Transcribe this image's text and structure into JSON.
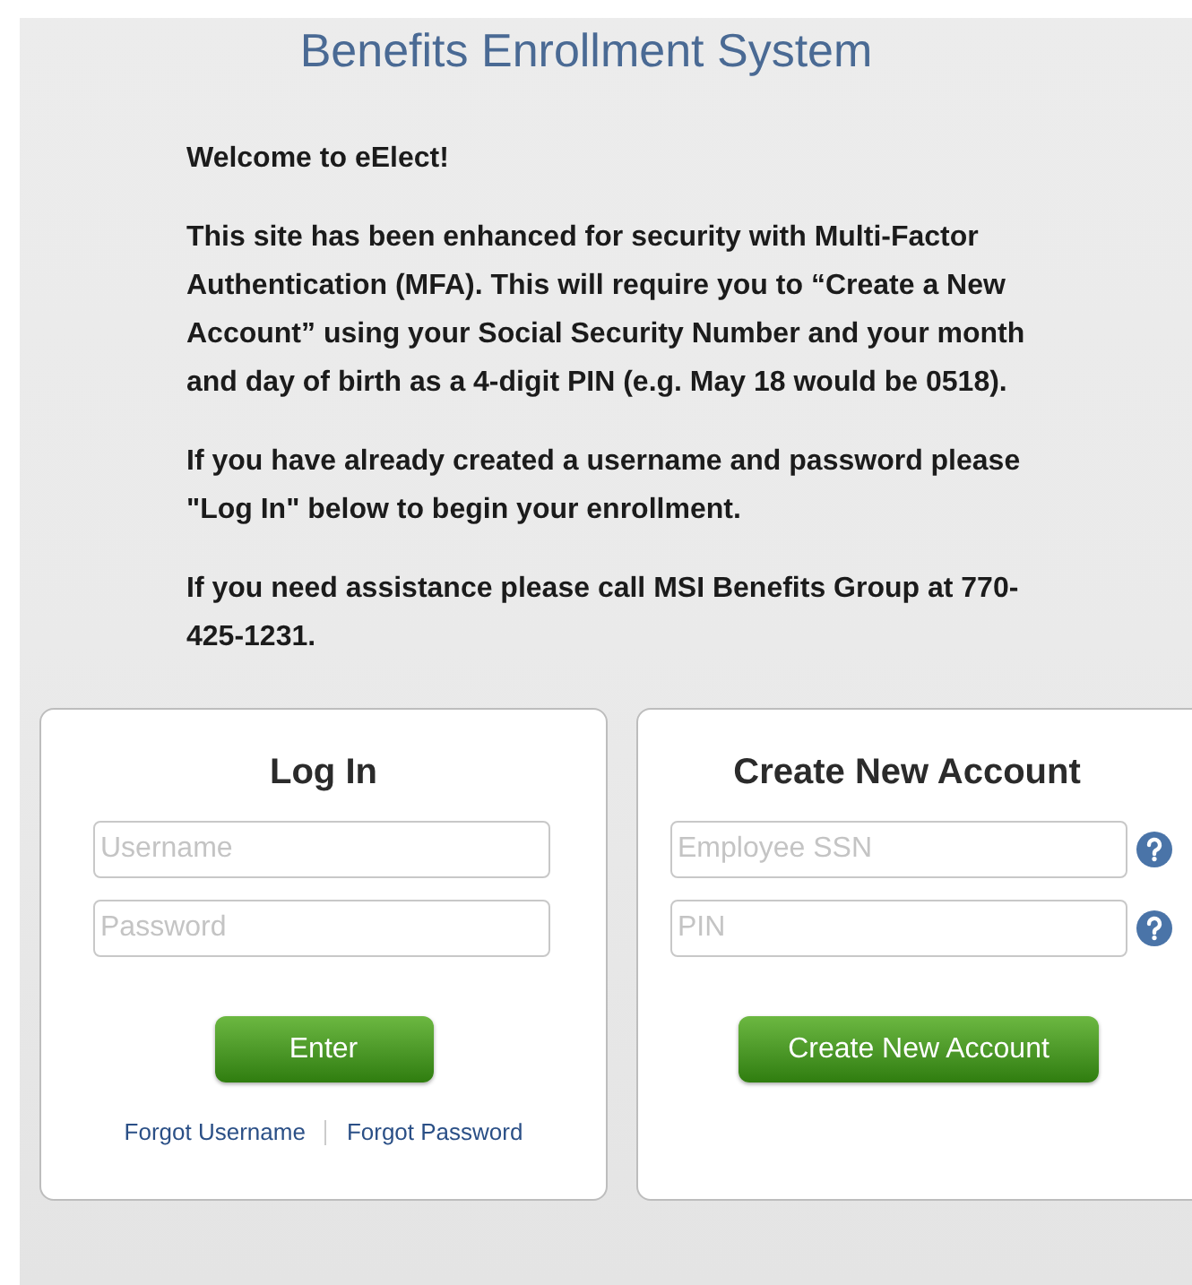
{
  "title": "Benefits Enrollment System",
  "intro": {
    "heading": "Welcome to eElect!",
    "paragraphs": [
      "This site has been enhanced for security with Multi-Factor Authentication (MFA). This will require you to “Create a New Account” using your Social Security Number and your month and day of birth as a 4-digit PIN (e.g. May 18 would be 0518).",
      "If you have already created a username and password please \"Log In\" below to begin your enrollment.",
      "If you need assistance please call MSI Benefits Group at 770-425-1231."
    ]
  },
  "login": {
    "title": "Log In",
    "fields": [
      {
        "placeholder": "Username"
      },
      {
        "placeholder": "Password"
      }
    ],
    "button": "Enter",
    "links": [
      "Forgot Username",
      "Forgot Password"
    ]
  },
  "create_account": {
    "title": "Create New Account",
    "fields": [
      {
        "placeholder": "Employee SSN",
        "help": true
      },
      {
        "placeholder": "PIN",
        "help": true
      }
    ],
    "button": "Create New Account"
  }
}
